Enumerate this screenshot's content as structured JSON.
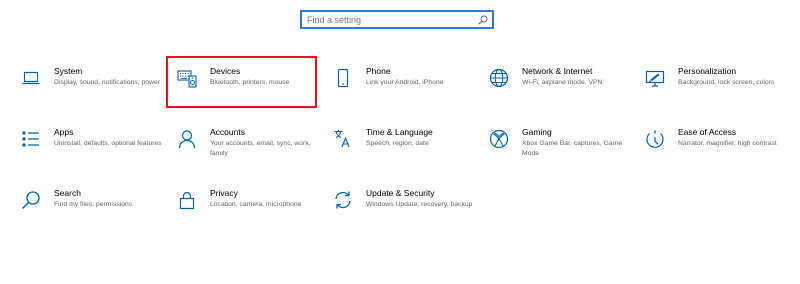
{
  "search": {
    "placeholder": "Find a setting",
    "icon": "search-icon"
  },
  "accent_color": "#0063b1",
  "highlight_color": "#e8111d",
  "settings": {
    "system": {
      "title": "System",
      "desc": "Display, sound, notifications, power",
      "icon": "laptop-icon"
    },
    "devices": {
      "title": "Devices",
      "desc": "Bluetooth, printers, mouse",
      "icon": "keyboard-speaker-icon",
      "highlighted": true
    },
    "phone": {
      "title": "Phone",
      "desc": "Link your Android, iPhone",
      "icon": "phone-icon"
    },
    "network": {
      "title": "Network & Internet",
      "desc": "Wi-Fi, airplane mode, VPN",
      "icon": "globe-icon"
    },
    "personalization": {
      "title": "Personalization",
      "desc": "Background, lock screen, colors",
      "icon": "monitor-brush-icon"
    },
    "apps": {
      "title": "Apps",
      "desc": "Uninstall, defaults, optional features",
      "icon": "apps-list-icon"
    },
    "accounts": {
      "title": "Accounts",
      "desc": "Your accounts, email, sync, work, family",
      "icon": "person-icon"
    },
    "time_language": {
      "title": "Time & Language",
      "desc": "Speech, region, date",
      "icon": "time-language-icon"
    },
    "gaming": {
      "title": "Gaming",
      "desc": "Xbox Game Bar, captures, Game Mode",
      "icon": "xbox-icon"
    },
    "ease_of_access": {
      "title": "Ease of Access",
      "desc": "Narrator, magnifier, high contrast",
      "icon": "ease-of-access-icon"
    },
    "search": {
      "title": "Search",
      "desc": "Find my files, permissions",
      "icon": "search-icon"
    },
    "privacy": {
      "title": "Privacy",
      "desc": "Location, camera, microphone",
      "icon": "lock-icon"
    },
    "update_security": {
      "title": "Update & Security",
      "desc": "Windows Update, recovery, backup",
      "icon": "sync-icon"
    }
  }
}
